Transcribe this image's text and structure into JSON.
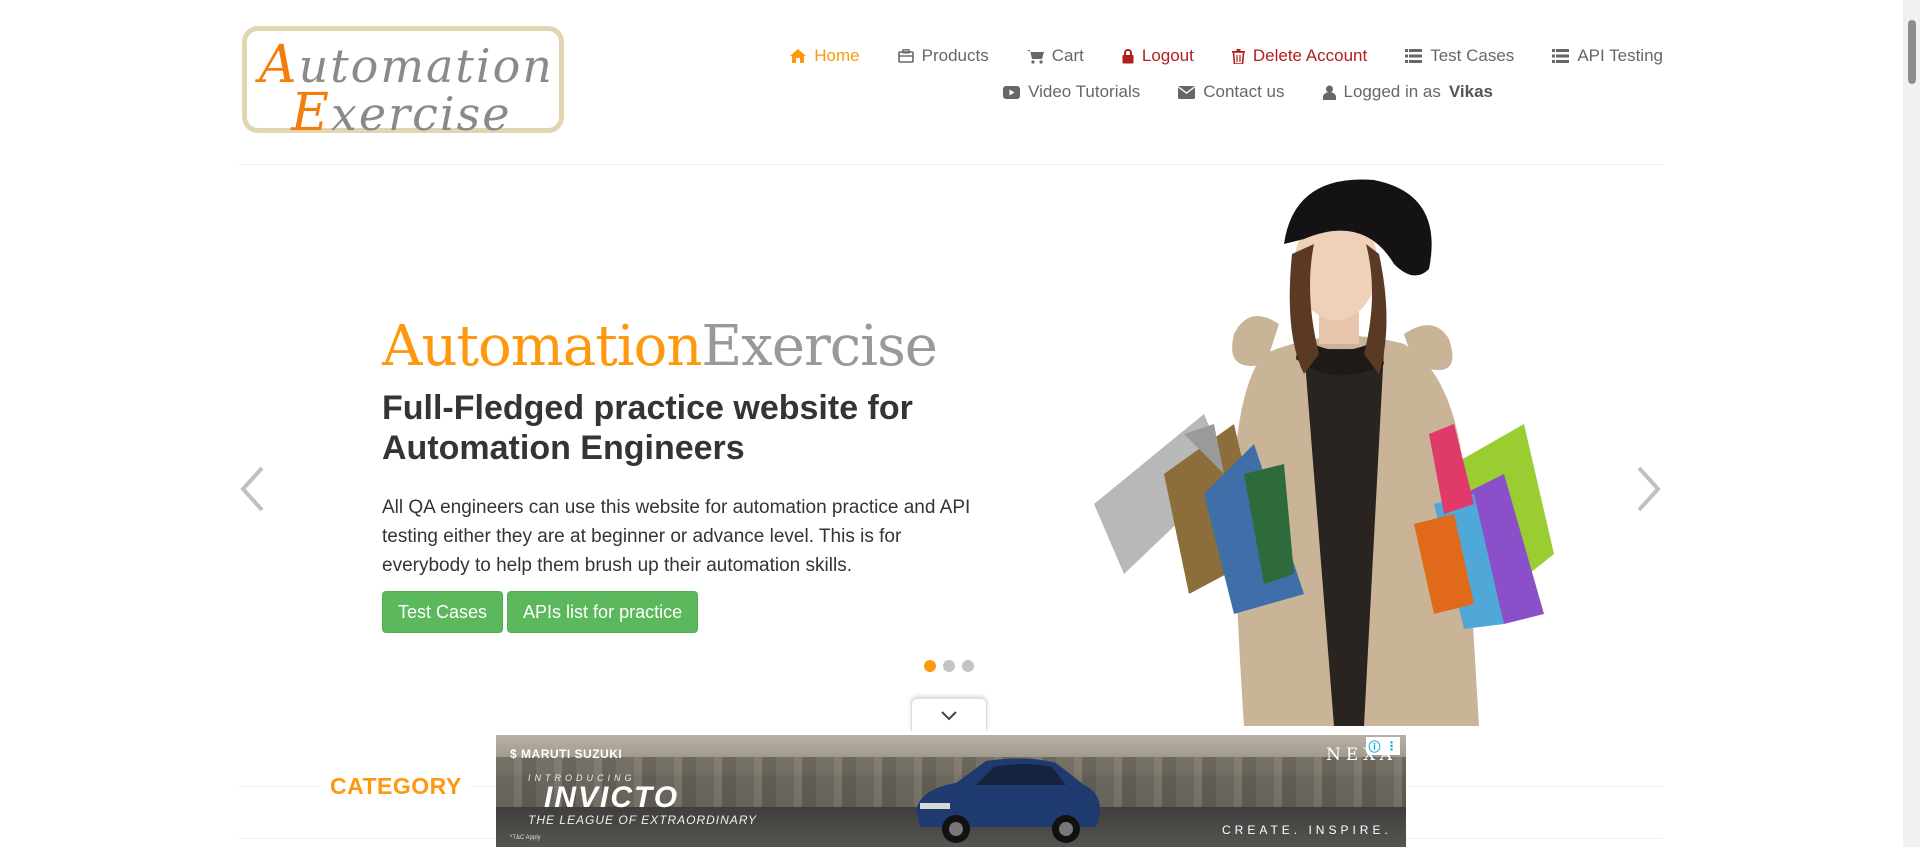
{
  "logo": {
    "line1_cap": "A",
    "line1_rest": "utomation",
    "line2_cap": "E",
    "line2_rest": "xercise"
  },
  "nav": {
    "row1": [
      {
        "name": "nav-home",
        "label": "Home",
        "icon": "home-icon",
        "style": "active"
      },
      {
        "name": "nav-products",
        "label": "Products",
        "icon": "briefcase-icon",
        "style": ""
      },
      {
        "name": "nav-cart",
        "label": "Cart",
        "icon": "cart-icon",
        "style": ""
      },
      {
        "name": "nav-logout",
        "label": "Logout",
        "icon": "lock-icon",
        "style": "red"
      },
      {
        "name": "nav-delete-account",
        "label": "Delete Account",
        "icon": "trash-icon",
        "style": "red"
      },
      {
        "name": "nav-test-cases",
        "label": "Test Cases",
        "icon": "list-icon",
        "style": ""
      },
      {
        "name": "nav-api-testing",
        "label": "API Testing",
        "icon": "list-icon",
        "style": ""
      }
    ],
    "row2": [
      {
        "name": "nav-video-tutorials",
        "label": "Video Tutorials",
        "icon": "youtube-play-icon",
        "style": ""
      },
      {
        "name": "nav-contact-us",
        "label": "Contact us",
        "icon": "envelope-icon",
        "style": ""
      }
    ],
    "logged_in_prefix": "Logged in as",
    "logged_in_user": "Vikas"
  },
  "slider": {
    "brand_part1": "Automation",
    "brand_part2": "Exercise",
    "headline": "Full-Fledged practice website for Automation Engineers",
    "description": "All QA engineers can use this website for automation practice and API testing either they are at beginner or advance level. This is for everybody to help them brush up their automation skills.",
    "button_test_cases": "Test Cases",
    "button_apis": "APIs list for practice",
    "slide_count": 3,
    "active_slide": 1
  },
  "category": {
    "title": "CATEGORY"
  },
  "ad": {
    "brand": "MARUTI SUZUKI",
    "intro": "INTRODUCING",
    "model": "INVICTO",
    "tagline": "THE LEAGUE OF EXTRAORDINARY",
    "nexa": "NEXA",
    "slogan": "CREATE. INSPIRE.",
    "tc": "*T&C Apply"
  },
  "colors": {
    "accent": "#FE980F",
    "danger": "#b01e1e",
    "button": "#5cb85c",
    "text": "#696763"
  }
}
